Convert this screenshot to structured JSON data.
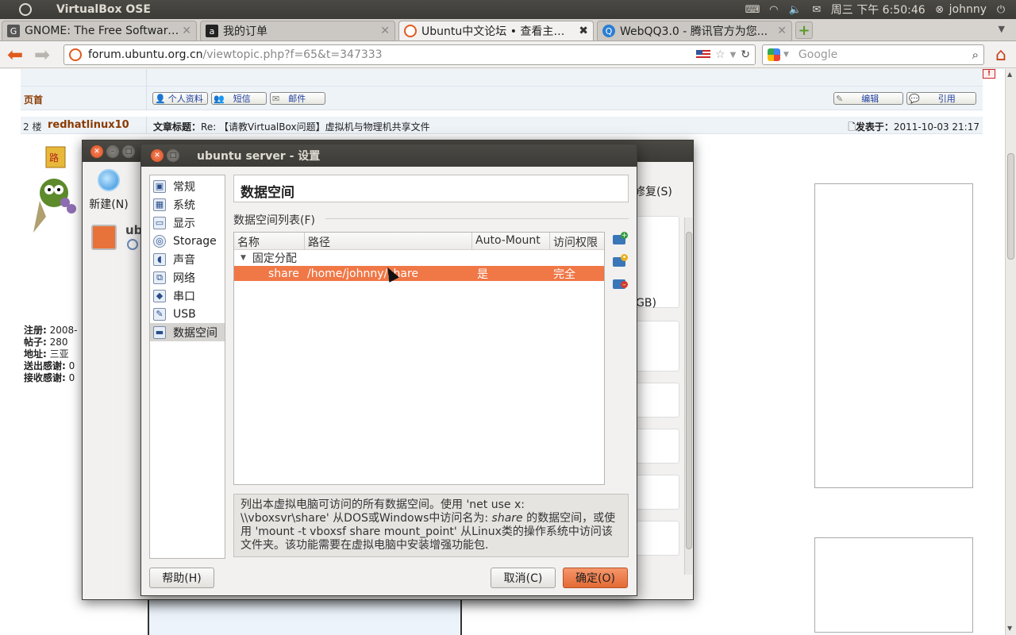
{
  "top_panel": {
    "app_title": "VirtualBox OSE",
    "clock": "周三 下午 6:50:46",
    "user": "johnny"
  },
  "tabs": [
    {
      "label": "GNOME: The Free Software ...",
      "active": false
    },
    {
      "label": "我的订单",
      "active": false
    },
    {
      "label": "Ubuntu中文论坛 • 查看主题 ...",
      "active": true
    },
    {
      "label": "WebQQ3.0 - 腾讯官方为您...",
      "active": false
    }
  ],
  "nav": {
    "url_host": "forum.ubuntu.org.cn",
    "url_path": "/viewtopic.php?f=65&t=347333",
    "search_placeholder": "Google"
  },
  "forum": {
    "page_top": "页首",
    "btn_profile": "个人资料",
    "btn_pm": "短信",
    "btn_email": "邮件",
    "btn_edit": "编辑",
    "btn_quote": "引用",
    "floor": "2 楼",
    "poster": "redhatlinux10",
    "post_title_label": "文章标题：",
    "post_title": "Re: 【请教VirtualBox问题】虚拟机与物理机共享文件",
    "post_date_label": "发表于：",
    "post_date": "2011-10-03 21:17",
    "info": [
      {
        "label": "注册:",
        "value": "2008-"
      },
      {
        "label": "帖子:",
        "value": "280"
      },
      {
        "label": "地址:",
        "value": "三亚"
      },
      {
        "label": "送出感谢:",
        "value": "0"
      },
      {
        "label": "接收感谢:",
        "value": "0"
      }
    ]
  },
  "vbox_manager": {
    "new_label": "新建(N)",
    "vm_name": "ubu",
    "discard_label": "修复(S)",
    "gb_label": "GB)"
  },
  "settings": {
    "title": "ubuntu server - 设置",
    "nav_items": [
      {
        "label": "常规",
        "icon": "monitor-icon"
      },
      {
        "label": "系统",
        "icon": "chip-icon"
      },
      {
        "label": "显示",
        "icon": "display-icon"
      },
      {
        "label": "Storage",
        "icon": "disk-icon"
      },
      {
        "label": "声音",
        "icon": "speaker-icon"
      },
      {
        "label": "网络",
        "icon": "network-icon"
      },
      {
        "label": "串口",
        "icon": "serial-port-icon"
      },
      {
        "label": "USB",
        "icon": "usb-icon"
      },
      {
        "label": "数据空间",
        "icon": "folder-icon"
      }
    ],
    "selected_index": 8,
    "page_title": "数据空间",
    "group_label": "数据空间列表(F)",
    "columns": [
      "名称",
      "路径",
      "Auto-Mount",
      "访问权限"
    ],
    "group_row": "固定分配",
    "share": {
      "name": "share",
      "path": "/home/johnny/share",
      "auto_mount": "是",
      "access": "完全"
    },
    "desc_1": "列出本虚拟电脑可访问的所有数据空间。使用 'net use x:",
    "desc_2": "\\\\vboxsvr\\share' 从DOS或Windows中访问名为: ",
    "desc_share": "share",
    "desc_3": " 的数据空间，或使用 'mount -t vboxsf share mount_point' 从Linux类的操作系统中访问该文件夹。该功能需要在虚拟电脑中安装增强功能包.",
    "help_label": "帮助(H)",
    "cancel_label": "取消(C)",
    "ok_label": "确定(O)"
  },
  "colors": {
    "accent": "#f07746",
    "panel": "#3c3b37"
  }
}
